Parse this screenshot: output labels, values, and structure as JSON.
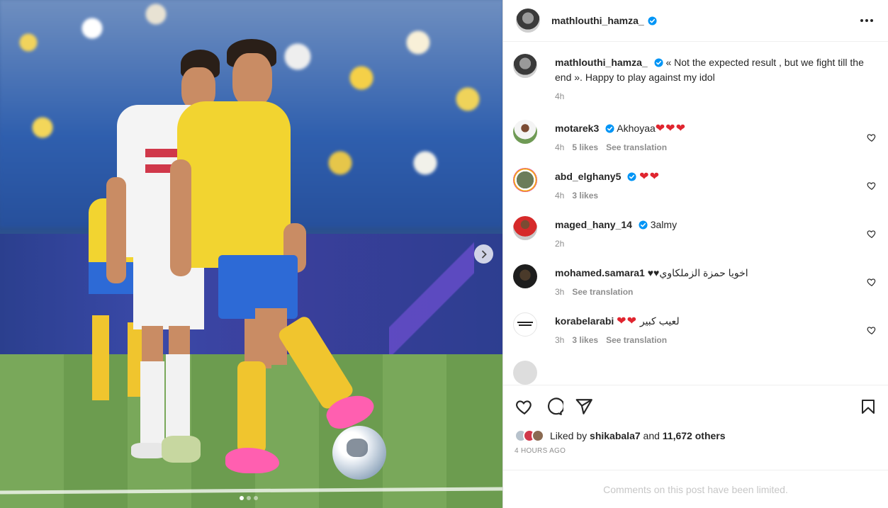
{
  "post": {
    "author": "mathlouthi_hamza_",
    "caption": "« Not the expected result , but we fight till the end ». Happy to play against my idol",
    "caption_time": "4h"
  },
  "media": {
    "carousel_count": 3,
    "carousel_active": 1
  },
  "comments": [
    {
      "username": "motarek3",
      "verified": true,
      "text": "Akhoyaa",
      "emoji": "❤❤❤",
      "time": "4h",
      "likes": "5 likes",
      "translation": "See translation"
    },
    {
      "username": "abd_elghany5",
      "verified": true,
      "text": "",
      "emoji": "❤❤",
      "time": "4h",
      "likes": "3 likes",
      "translation": ""
    },
    {
      "username": "maged_hany_14",
      "verified": true,
      "text": "3almy",
      "emoji": "",
      "time": "2h",
      "likes": "",
      "translation": ""
    },
    {
      "username": "mohamed.samara1",
      "verified": false,
      "text": "اخويا حمزة الزملكاوي♥♥",
      "emoji": "",
      "time": "3h",
      "likes": "",
      "translation": "See translation"
    },
    {
      "username": "korabelarabi",
      "verified": false,
      "text": "لعيب كبير",
      "emoji": "❤❤",
      "time": "3h",
      "likes": "3 likes",
      "translation": "See translation"
    }
  ],
  "likes": {
    "prefix": "Liked by",
    "top_user": "shikabala7",
    "and": "and",
    "others": "11,672 others",
    "timestamp": "4 HOURS AGO"
  },
  "footer": {
    "limited_text": "Comments on this post have been limited."
  },
  "colors": {
    "verified": "#0095f6",
    "heart": "#e0252f",
    "muted": "#8e8e8e"
  }
}
